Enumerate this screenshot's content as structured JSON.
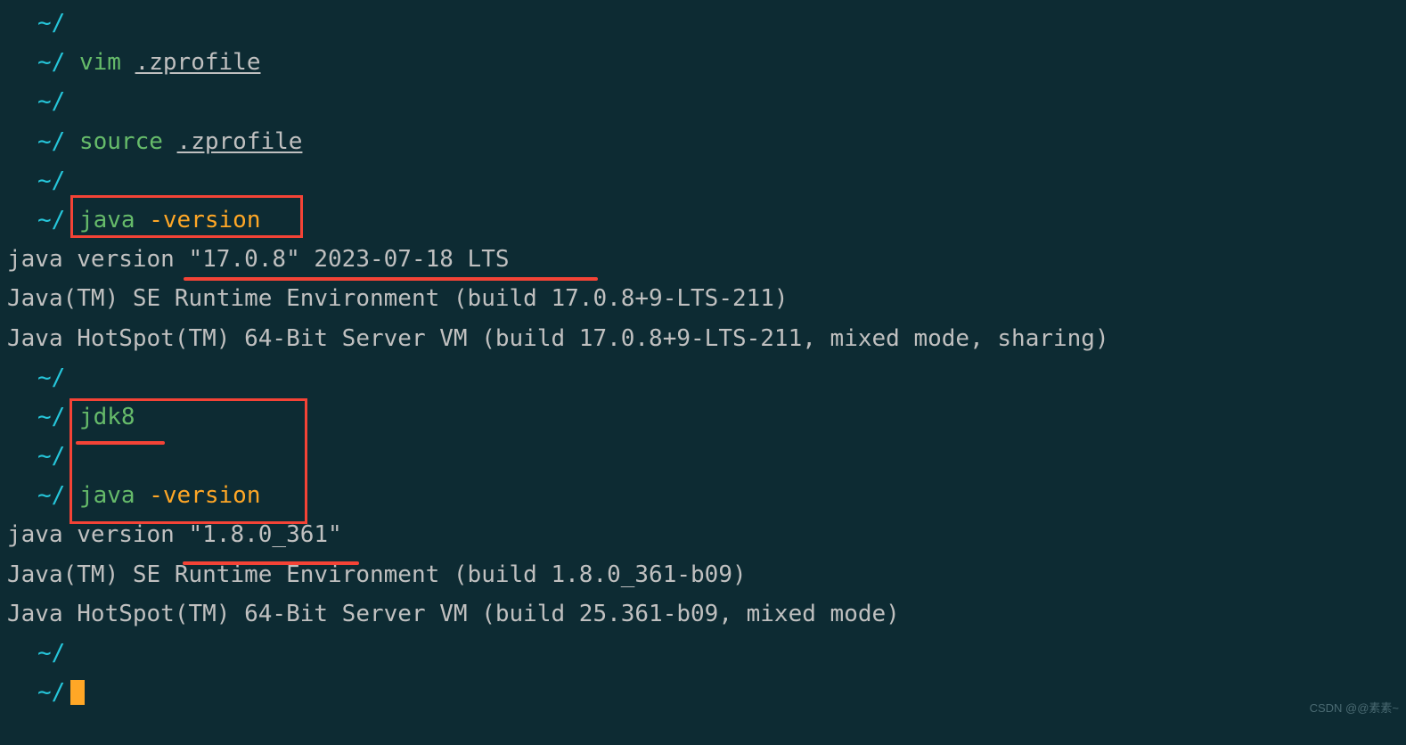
{
  "prompt": {
    "apple_char": "",
    "path": "~/"
  },
  "commands": {
    "vim": "vim",
    "zprofile": ".zprofile",
    "source": "source",
    "java": "java",
    "version_flag": "-version",
    "jdk8": "jdk8"
  },
  "output": {
    "java17_line1": "java version \"17.0.8\" 2023-07-18 LTS",
    "java17_line2": "Java(TM) SE Runtime Environment (build 17.0.8+9-LTS-211)",
    "java17_line3": "Java HotSpot(TM) 64-Bit Server VM (build 17.0.8+9-LTS-211, mixed mode, sharing)",
    "java8_line1": "java version \"1.8.0_361\"",
    "java8_line2": "Java(TM) SE Runtime Environment (build 1.8.0_361-b09)",
    "java8_line3": "Java HotSpot(TM) 64-Bit Server VM (build 25.361-b09, mixed mode)"
  },
  "watermark": "CSDN @@素素~"
}
